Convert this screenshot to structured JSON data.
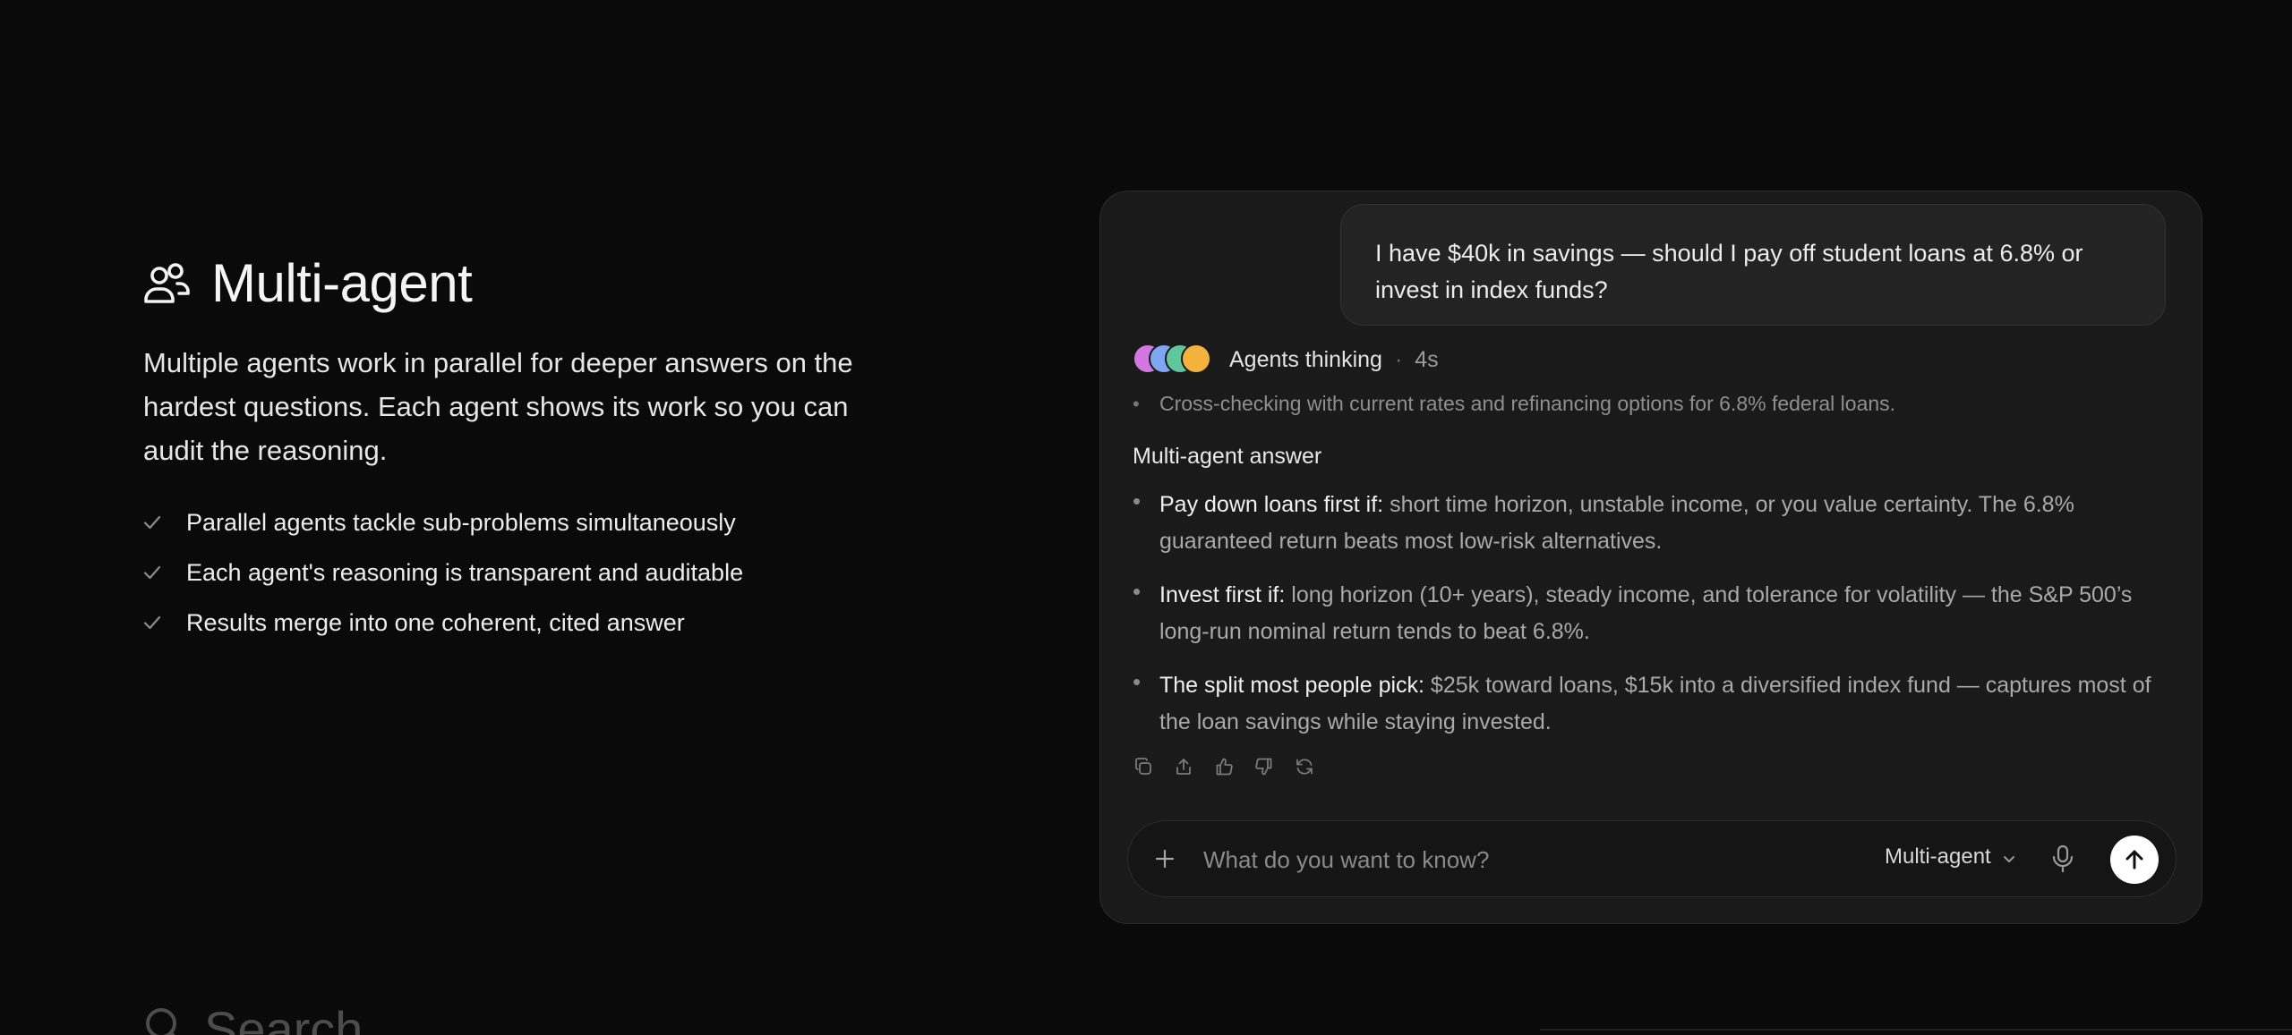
{
  "feature": {
    "icon": "users-icon",
    "title": "Multi-agent",
    "description": "Multiple agents work in parallel for deeper answers on the hardest questions. Each agent shows its work so you can audit the reasoning.",
    "bullets": [
      "Parallel agents tackle sub-problems simultaneously",
      "Each agent's reasoning is transparent and auditable",
      "Results merge into one coherent, cited answer"
    ]
  },
  "next_feature": {
    "icon": "search-icon",
    "title": "Search"
  },
  "chat": {
    "user_message": "I have $40k in savings — should I pay off student loans at 6.8% or invest in index funds?",
    "status": {
      "label": "Agents thinking",
      "separator": "·",
      "elapsed": "4s"
    },
    "agent_colors": [
      "#d277e0",
      "#7ea6f2",
      "#5fc79b",
      "#f2b23c"
    ],
    "thought": "Cross-checking with current rates and refinancing options for 6.8% federal loans.",
    "answer_heading": "Multi-agent answer",
    "answer_points": [
      {
        "lead": "Pay down loans first if:",
        "text": " short time horizon, unstable income, or you value certainty. The 6.8% guaranteed return beats most low-risk alternatives."
      },
      {
        "lead": "Invest first if:",
        "text": " long horizon (10+ years), steady income, and tolerance for volatility — the S&P 500’s long-run nominal return tends to beat 6.8%."
      },
      {
        "lead": "The split most people pick:",
        "text": " $25k toward loans, $15k into a diversified index fund — captures most of the loan savings while staying invested."
      }
    ],
    "actions": [
      "copy-icon",
      "share-icon",
      "thumbs-up-icon",
      "thumbs-down-icon",
      "regenerate-icon"
    ],
    "composer": {
      "placeholder": "What do you want to know?",
      "mode_label": "Multi-agent"
    }
  }
}
